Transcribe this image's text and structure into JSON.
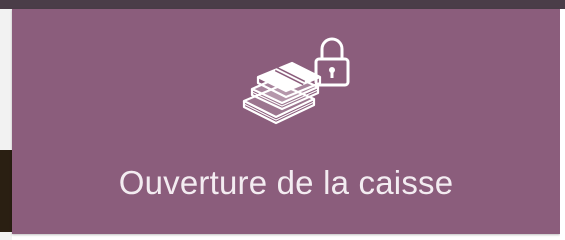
{
  "cash_open_button": {
    "label": "Ouverture de la caisse",
    "icon": "locked-cash-icon"
  },
  "colors": {
    "button_background": "#8b5d7c",
    "top_bar": "#4a3d48",
    "label_text": "#f3ecf1"
  }
}
